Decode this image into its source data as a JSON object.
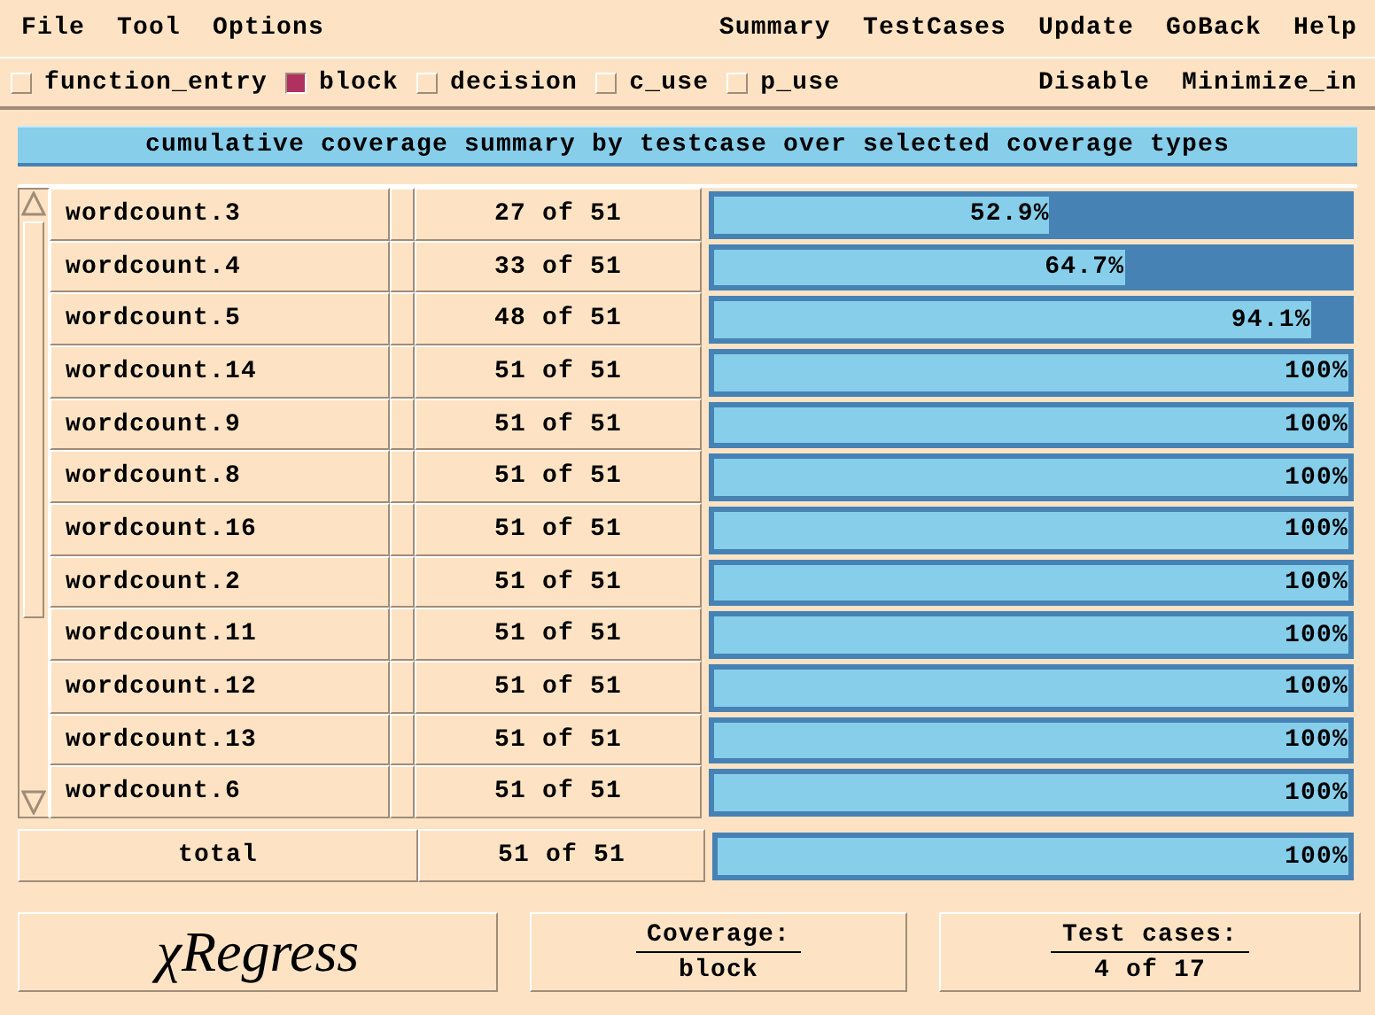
{
  "menu_left": [
    "File",
    "Tool",
    "Options"
  ],
  "menu_right": [
    "Summary",
    "TestCases",
    "Update",
    "GoBack",
    "Help"
  ],
  "coverage_types": [
    {
      "label": "function_entry",
      "checked": false
    },
    {
      "label": "block",
      "checked": true
    },
    {
      "label": "decision",
      "checked": false
    },
    {
      "label": "c_use",
      "checked": false
    },
    {
      "label": "p_use",
      "checked": false
    }
  ],
  "toolbar_buttons": [
    "Disable",
    "Minimize_in"
  ],
  "title": "cumulative coverage summary by testcase over selected coverage types",
  "rows": [
    {
      "name": "wordcount.3",
      "count": "27 of 51",
      "level": 0.529,
      "percent": "52.9%"
    },
    {
      "name": "wordcount.4",
      "count": "33 of 51",
      "level": 0.647,
      "percent": "64.7%"
    },
    {
      "name": "wordcount.5",
      "count": "48 of 51",
      "level": 0.941,
      "percent": "94.1%"
    },
    {
      "name": "wordcount.14",
      "count": "51 of 51",
      "level": 1,
      "percent": "100%"
    },
    {
      "name": "wordcount.9",
      "count": "51 of 51",
      "level": 1,
      "percent": "100%"
    },
    {
      "name": "wordcount.8",
      "count": "51 of 51",
      "level": 1,
      "percent": "100%"
    },
    {
      "name": "wordcount.16",
      "count": "51 of 51",
      "level": 1,
      "percent": "100%"
    },
    {
      "name": "wordcount.2",
      "count": "51 of 51",
      "level": 1,
      "percent": "100%"
    },
    {
      "name": "wordcount.11",
      "count": "51 of 51",
      "level": 1,
      "percent": "100%"
    },
    {
      "name": "wordcount.12",
      "count": "51 of 51",
      "level": 1,
      "percent": "100%"
    },
    {
      "name": "wordcount.13",
      "count": "51 of 51",
      "level": 1,
      "percent": "100%"
    },
    {
      "name": "wordcount.6",
      "count": "51 of 51",
      "level": 1,
      "percent": "100%"
    }
  ],
  "total": {
    "name": "total",
    "count": "51 of 51",
    "level": 1,
    "percent": "100%"
  },
  "logo": "χRegress",
  "coverage": {
    "label": "Coverage:",
    "value": "block"
  },
  "test_cases": {
    "label": "Test cases:",
    "value": "4 of 17"
  }
}
